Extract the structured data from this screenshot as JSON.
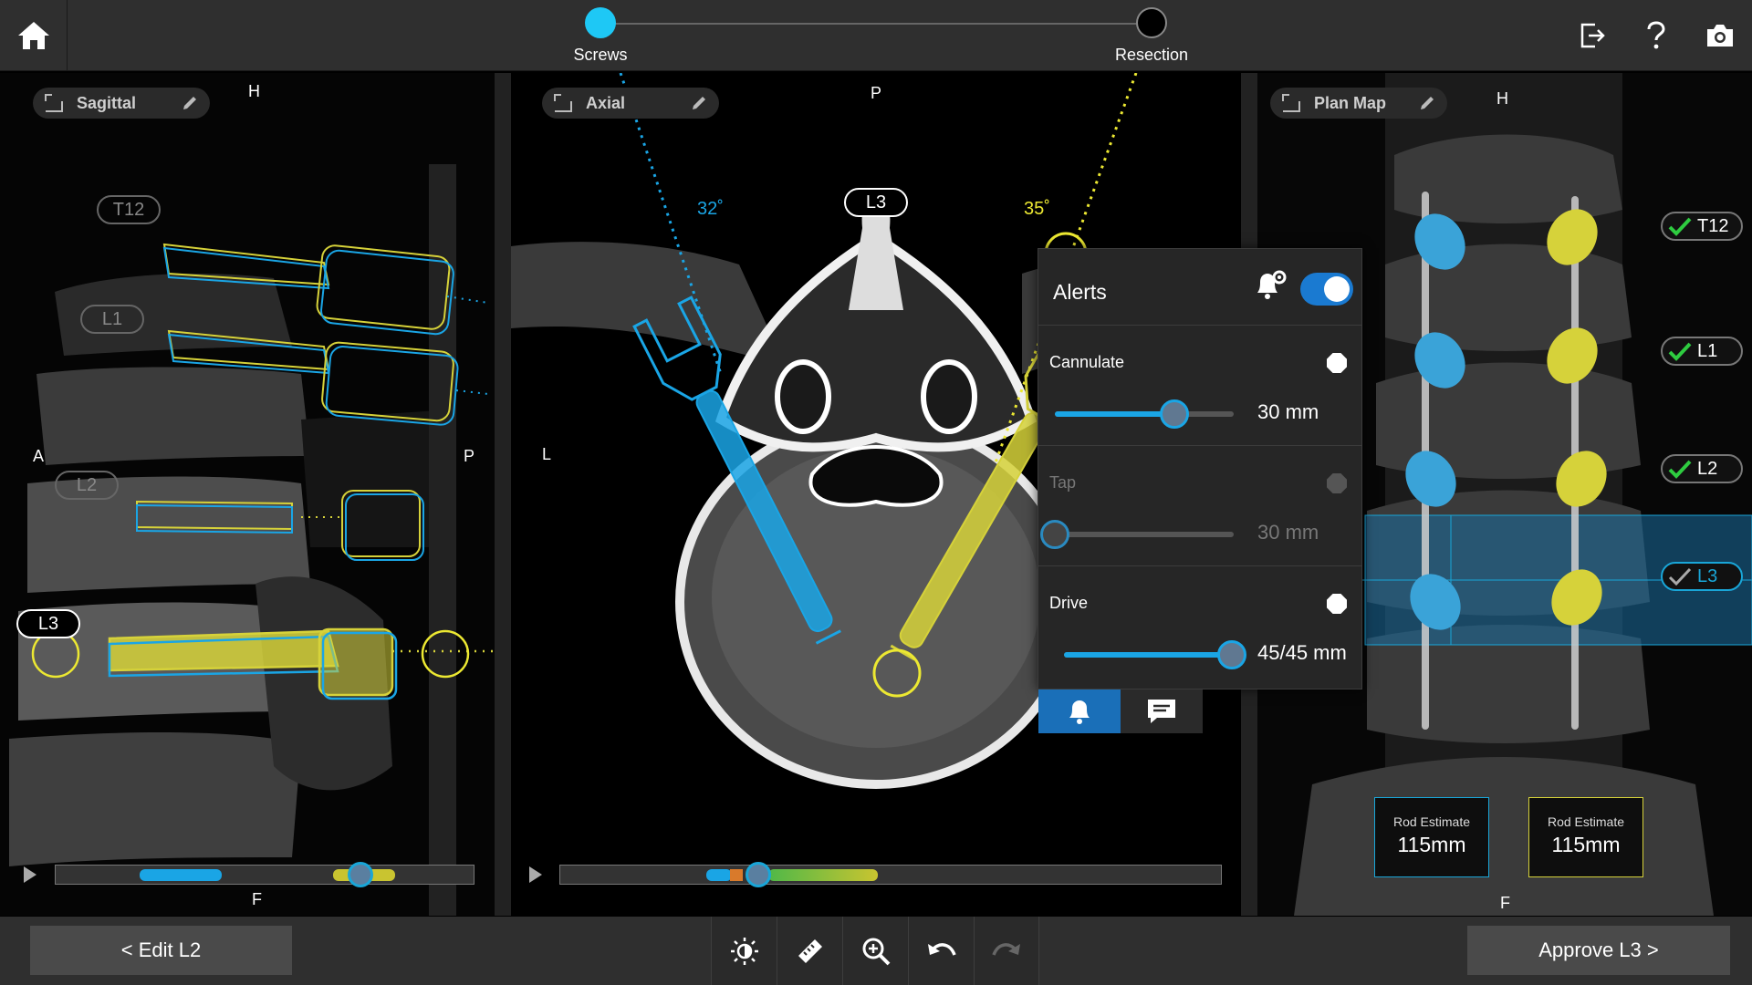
{
  "colors": {
    "accent": "#19a6d8",
    "left_screw": "#1aa5e5",
    "right_screw": "#d6d23a",
    "check": "#2ecc40"
  },
  "icons": {
    "home": "home-icon",
    "exit": "exit-icon",
    "help": "help-icon",
    "camera": "camera-icon"
  },
  "steps": [
    {
      "label": "Screws",
      "state": "active"
    },
    {
      "label": "Resection",
      "state": "pending"
    }
  ],
  "sagittal": {
    "title": "Sagittal",
    "orient": {
      "top": "H",
      "left": "A",
      "right": "P",
      "bottom": "F"
    },
    "levels": [
      "T12",
      "L1",
      "L2",
      "L3"
    ],
    "scrub_value": 0.73
  },
  "axial": {
    "title": "Axial",
    "orient": {
      "top": "P",
      "left": "L"
    },
    "level": "L3",
    "angle_left": "32˚",
    "angle_right": "35˚",
    "scrub_value": 0.3
  },
  "plan_map": {
    "title": "Plan Map",
    "orient": {
      "top": "H",
      "bottom": "F"
    },
    "levels": [
      {
        "label": "T12",
        "approved": true
      },
      {
        "label": "L1",
        "approved": true
      },
      {
        "label": "L2",
        "approved": true
      },
      {
        "label": "L3",
        "approved": false
      }
    ],
    "rod_left": {
      "title": "Rod Estimate",
      "value": "115mm"
    },
    "rod_right": {
      "title": "Rod Estimate",
      "value": "115mm"
    }
  },
  "alerts": {
    "title": "Alerts",
    "enabled": true,
    "sections": [
      {
        "name": "Cannulate",
        "value": "30 mm",
        "fill": 0.67,
        "enabled": true
      },
      {
        "name": "Tap",
        "value": "30 mm",
        "fill": 0.0,
        "enabled": false
      },
      {
        "name": "Drive",
        "value": "45/45 mm",
        "fill": 1.0,
        "enabled": true
      }
    ]
  },
  "bottom": {
    "prev_label": "< Edit L2",
    "next_label": "Approve L3 >"
  }
}
